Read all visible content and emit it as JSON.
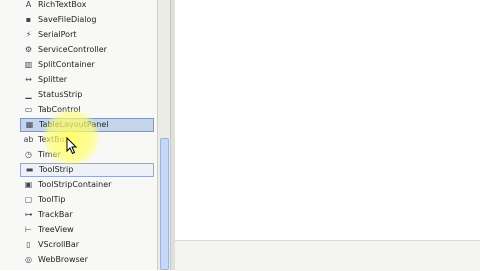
{
  "toolbox": {
    "items": [
      {
        "label": "RichTextBox",
        "icon": "rich-text-icon",
        "glyph": "A",
        "state": ""
      },
      {
        "label": "SaveFileDialog",
        "icon": "save-file-icon",
        "glyph": "▪",
        "state": ""
      },
      {
        "label": "SerialPort",
        "icon": "serial-port-icon",
        "glyph": "⚡",
        "state": ""
      },
      {
        "label": "ServiceController",
        "icon": "service-controller-icon",
        "glyph": "⚙",
        "state": ""
      },
      {
        "label": "SplitContainer",
        "icon": "split-container-icon",
        "glyph": "▥",
        "state": ""
      },
      {
        "label": "Splitter",
        "icon": "splitter-icon",
        "glyph": "↔",
        "state": ""
      },
      {
        "label": "StatusStrip",
        "icon": "status-strip-icon",
        "glyph": "▁",
        "state": ""
      },
      {
        "label": "TabControl",
        "icon": "tab-control-icon",
        "glyph": "▭",
        "state": ""
      },
      {
        "label": "TableLayoutPanel",
        "icon": "table-layout-icon",
        "glyph": "▦",
        "state": "selected"
      },
      {
        "label": "TextBox",
        "icon": "textbox-icon",
        "glyph": "ab",
        "state": ""
      },
      {
        "label": "Timer",
        "icon": "timer-icon",
        "glyph": "◷",
        "state": ""
      },
      {
        "label": "ToolStrip",
        "icon": "toolstrip-icon",
        "glyph": "▬",
        "state": "hover"
      },
      {
        "label": "ToolStripContainer",
        "icon": "toolstrip-container-icon",
        "glyph": "▣",
        "state": ""
      },
      {
        "label": "ToolTip",
        "icon": "tooltip-icon",
        "glyph": "▢",
        "state": ""
      },
      {
        "label": "TrackBar",
        "icon": "trackbar-icon",
        "glyph": "⊶",
        "state": ""
      },
      {
        "label": "TreeView",
        "icon": "treeview-icon",
        "glyph": "⊢",
        "state": ""
      },
      {
        "label": "VScrollBar",
        "icon": "vscrollbar-icon",
        "glyph": "▯",
        "state": ""
      },
      {
        "label": "WebBrowser",
        "icon": "webbrowser-icon",
        "glyph": "◎",
        "state": ""
      }
    ]
  }
}
